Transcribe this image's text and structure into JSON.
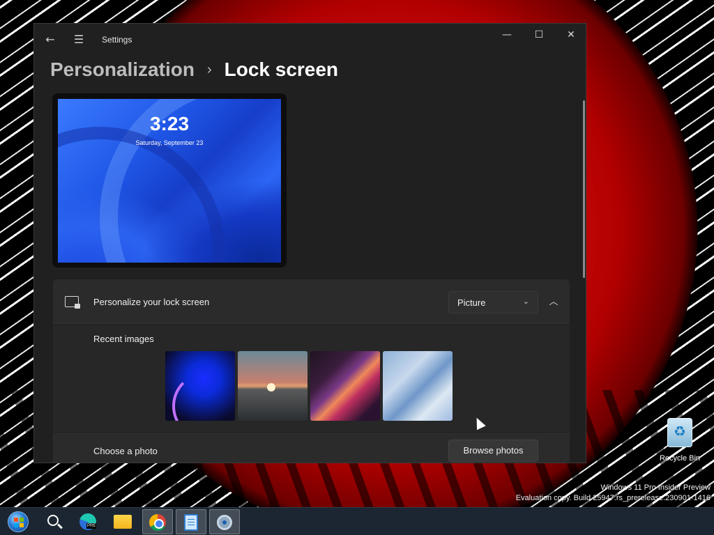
{
  "window": {
    "title": "Settings",
    "controls": {
      "minimize": "—",
      "maximize": "☐",
      "close": "✕"
    }
  },
  "breadcrumb": {
    "parent": "Personalization",
    "separator": "›",
    "current": "Lock screen"
  },
  "preview": {
    "time": "3:23",
    "date": "Saturday, September 23"
  },
  "personalize": {
    "title": "Personalize your lock screen",
    "dropdown_value": "Picture",
    "dropdown_icon": "chevron-down-icon",
    "collapse_icon": "chevron-up-icon"
  },
  "recent_images": {
    "label": "Recent images",
    "items": [
      "bloom-blue",
      "sunset-lake",
      "purple-ribbon",
      "light-blue-waves"
    ]
  },
  "choose_photo": {
    "label": "Choose a photo",
    "button": "Browse photos"
  },
  "desktop": {
    "recycle_bin_label": "Recycle Bin",
    "watermark_line1": "Windows 11 Pro Insider Preview",
    "watermark_line2": "Evaluation copy. Build 25947.rs_prerelease.230901-1416"
  },
  "taskbar": {
    "items": [
      "start",
      "search",
      "edge-preview",
      "file-explorer",
      "chrome",
      "notepad",
      "settings"
    ]
  },
  "colors": {
    "window_bg": "#202020",
    "card_bg": "#2b2b2b",
    "taskbar_bg": "#1c2632"
  }
}
